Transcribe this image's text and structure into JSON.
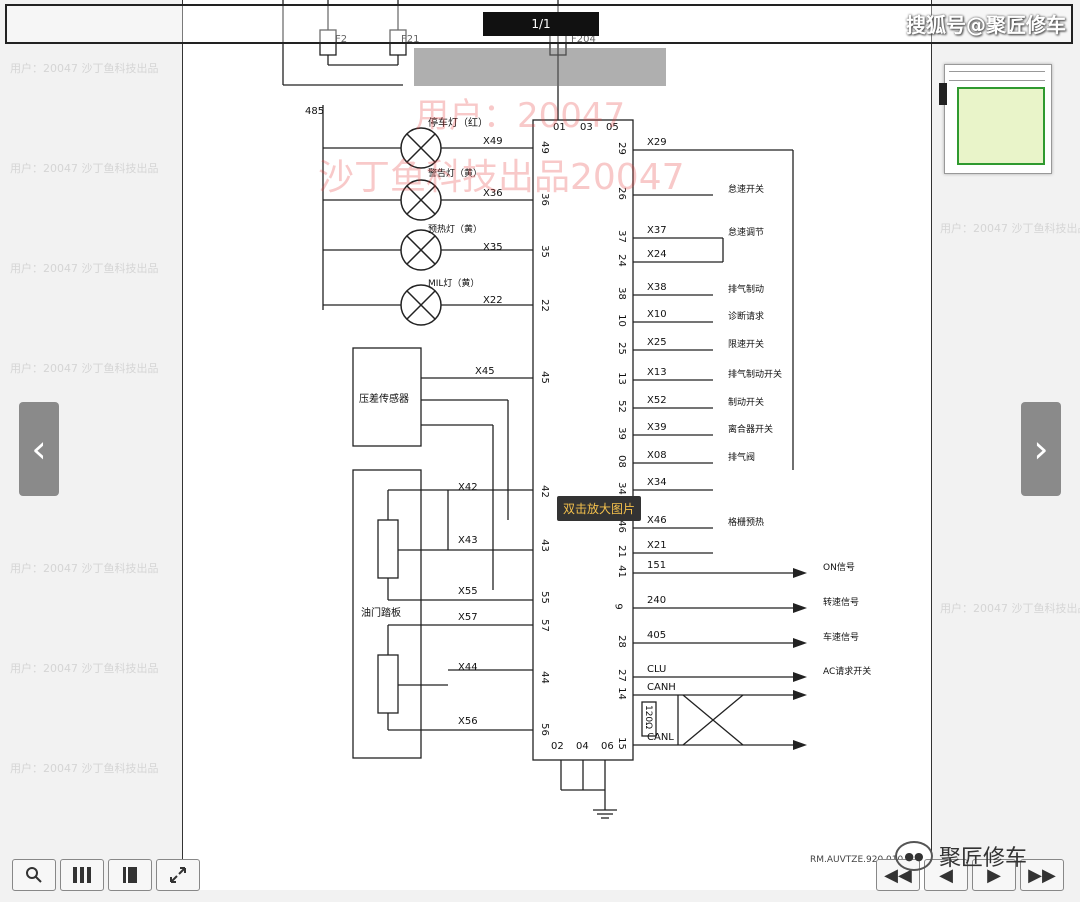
{
  "viewer": {
    "page_indicator": "1/1",
    "brand_top": "搜狐号@聚匠修车",
    "brand_bottom": "聚匠修车",
    "tooltip": "双击放大图片",
    "doc_ref": "RM.AUVTZE.920.010",
    "watermark_large": "用户：20047",
    "watermark_large2": "沙丁鱼科技出品20047",
    "watermark_small": "用户：20047 沙丁鱼科技出品",
    "nav_prev_icon": "chevron-left-icon",
    "nav_next_icon": "chevron-right-icon",
    "toolbar_icons": [
      "zoom-icon",
      "grid-icon",
      "book-icon",
      "fullscreen-icon"
    ],
    "pager_icons": [
      "first-page-icon",
      "prev-page-icon",
      "next-page-icon",
      "last-page-icon"
    ]
  },
  "diagram": {
    "fuses": [
      "F2",
      "F21",
      "F204"
    ],
    "wire_485": "485",
    "lamps": [
      {
        "label": "停车灯（红）",
        "pin": "X49",
        "ecu": "49"
      },
      {
        "label": "警告灯（黄）",
        "pin": "X36",
        "ecu": "36"
      },
      {
        "label": "预热灯（黄）",
        "pin": "X35",
        "ecu": "35"
      },
      {
        "label": "MIL灯（黄）",
        "pin": "X22",
        "ecu": "22"
      }
    ],
    "ecu_top_pins": [
      "01",
      "03",
      "05"
    ],
    "ecu_bottom_pins": [
      "02",
      "04",
      "06"
    ],
    "sensor_pressure": "压差传感器",
    "sensor_pin": "X45",
    "sensor_ecu_pin": "45",
    "pedal_label": "油门踏板",
    "pedal_pins": [
      {
        "pin": "X42",
        "ecu": "42"
      },
      {
        "pin": "X43",
        "ecu": "43"
      },
      {
        "pin": "X55",
        "ecu": "55"
      },
      {
        "pin": "X57",
        "ecu": "57"
      },
      {
        "pin": "X44",
        "ecu": "44"
      },
      {
        "pin": "X56",
        "ecu": "56"
      }
    ],
    "right_pins": [
      {
        "ecu": "29",
        "pin": "X29",
        "label": ""
      },
      {
        "ecu": "26",
        "pin": "",
        "label": "怠速开关"
      },
      {
        "ecu": "37",
        "pin": "X37",
        "label": "怠速调节"
      },
      {
        "ecu": "24",
        "pin": "X24",
        "label": ""
      },
      {
        "ecu": "38",
        "pin": "X38",
        "label": "排气制动"
      },
      {
        "ecu": "10",
        "pin": "X10",
        "label": "诊断请求"
      },
      {
        "ecu": "25",
        "pin": "X25",
        "label": "限速开关"
      },
      {
        "ecu": "13",
        "pin": "X13",
        "label": "排气制动开关"
      },
      {
        "ecu": "52",
        "pin": "X52",
        "label": "制动开关"
      },
      {
        "ecu": "39",
        "pin": "X39",
        "label": "离合器开关"
      },
      {
        "ecu": "08",
        "pin": "X08",
        "label": "排气阀"
      },
      {
        "ecu": "34",
        "pin": "X34",
        "label": ""
      },
      {
        "ecu": "46",
        "pin": "X46",
        "label": "格栅预热"
      },
      {
        "ecu": "21",
        "pin": "X21",
        "label": ""
      },
      {
        "ecu": "41",
        "pin": "151",
        "label": "ON信号"
      },
      {
        "ecu": "9",
        "pin": "240",
        "label": "转速信号"
      },
      {
        "ecu": "28",
        "pin": "405",
        "label": "车速信号"
      },
      {
        "ecu": "27",
        "pin": "CLU",
        "label": "AC请求开关"
      },
      {
        "ecu": "14",
        "pin": "CANH",
        "label": ""
      },
      {
        "ecu": "15",
        "pin": "CANL",
        "label": ""
      }
    ],
    "resistor": "120Ω"
  }
}
